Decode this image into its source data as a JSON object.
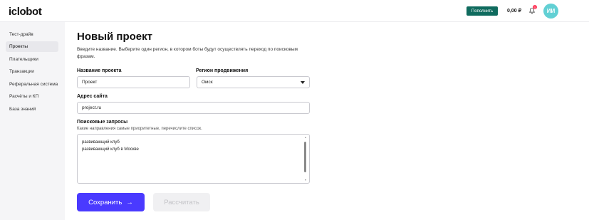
{
  "header": {
    "logo": "iclobot",
    "topup_label": "Пополнить",
    "balance": "0,00 ₽",
    "notifications_count": "1",
    "avatar_initials": "ИИ"
  },
  "sidebar": {
    "items": [
      {
        "label": "Тест-драйв",
        "active": false
      },
      {
        "label": "Проекты",
        "active": true
      },
      {
        "label": "Плательщики",
        "active": false
      },
      {
        "label": "Транзакции",
        "active": false
      },
      {
        "label": "Реферальная система",
        "active": false
      },
      {
        "label": "Расчёты и КП",
        "active": false
      },
      {
        "label": "База знаний",
        "active": false
      }
    ]
  },
  "main": {
    "title": "Новый проект",
    "intro": "Введите название. Выберите один регион, в котором боты будут осуществлять переход по поисковым фразам.",
    "project_name": {
      "label": "Название проекта",
      "value": "Проект"
    },
    "region": {
      "label": "Регион продвижения",
      "value": "Омск"
    },
    "site": {
      "label": "Адрес сайта",
      "value": "project.ru"
    },
    "queries": {
      "label": "Поисковые запросы",
      "hint": "Какие направления самые приоритетные, перечислите список.",
      "lines": [
        "развивающий клуб",
        "развивающий клуб в Москве"
      ]
    },
    "save_label": "Сохранить",
    "save_arrow": "→",
    "calc_label": "Рассчитать"
  },
  "colors": {
    "accent": "#4a3aff",
    "topup": "#0f6b5e",
    "avatar": "#62d0d4",
    "badge": "#ff3b5c"
  }
}
